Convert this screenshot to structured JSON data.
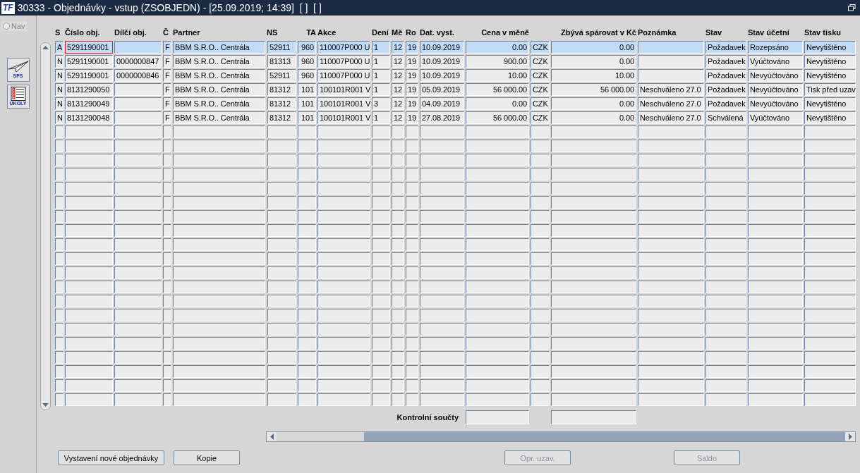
{
  "window": {
    "logo": "TF",
    "title": "30333 - Objednávky - vstup (ZSOBJEDN) - [25.09.2019; 14:39]  [ ]  [ ]"
  },
  "sidebar": {
    "nav": {
      "label": "Nav",
      "selected": false,
      "disabled": true
    },
    "buttons": [
      {
        "kind": "plane",
        "label": "SPS"
      },
      {
        "kind": "checklist",
        "label": "ÚKOLY"
      }
    ]
  },
  "table": {
    "columns": [
      "S",
      "Číslo obj.",
      "Dílčí obj.",
      "Č",
      "Partner",
      "NS",
      "TA",
      "Akce",
      "Dení",
      "Mě",
      "Ro",
      "Dat. vyst.",
      "Cena v měně",
      "",
      "Zbývá spárovat v Kč",
      "Poznámka",
      "Stav",
      "Stav účetní",
      "Stav tisku"
    ],
    "rows": [
      {
        "selected": true,
        "focused": true,
        "cells": [
          "A",
          "5291190001",
          null,
          "F",
          "BBM S.R.O.. Centrála",
          "52911",
          "960",
          "110007P000 U",
          "1",
          "12",
          "19",
          "10.09.2019",
          "0.00",
          "CZK",
          "0.00",
          null,
          "Požadavek",
          "Rozepsáno",
          "Nevytištěno"
        ]
      },
      {
        "selected": false,
        "focused": false,
        "cells": [
          "N",
          "5291190001",
          "0000000847",
          "F",
          "BBM S.R.O.. Centrála",
          "81313",
          "960",
          "110007P000 U",
          "1",
          "12",
          "19",
          "10.09.2019",
          "900.00",
          "CZK",
          "0.00",
          null,
          "Požadavek",
          "Vyúčtováno",
          "Nevytištěno"
        ]
      },
      {
        "selected": false,
        "focused": false,
        "cells": [
          "N",
          "5291190001",
          "0000000846",
          "F",
          "BBM S.R.O.. Centrála",
          "52911",
          "960",
          "110007P000 U",
          "1",
          "12",
          "19",
          "10.09.2019",
          "10.00",
          "CZK",
          "10.00",
          null,
          "Požadavek",
          "Nevyúčtováno",
          "Nevytištěno"
        ]
      },
      {
        "selected": false,
        "focused": false,
        "cells": [
          "N",
          "8131290050",
          null,
          "F",
          "BBM S.R.O.. Centrála",
          "81312",
          "101",
          "100101R001 V",
          "1",
          "12",
          "19",
          "05.09.2019",
          "56 000.00",
          "CZK",
          "56 000.00",
          "Neschváleno 27.0",
          "Požadavek",
          "Nevyúčtováno",
          "Tisk před uzav"
        ]
      },
      {
        "selected": false,
        "focused": false,
        "cells": [
          "N",
          "8131290049",
          null,
          "F",
          "BBM S.R.O.. Centrála",
          "81312",
          "101",
          "100101R001 V",
          "3",
          "12",
          "19",
          "04.09.2019",
          "0.00",
          "CZK",
          "0.00",
          "Neschváleno 27.0",
          "Požadavek",
          "Nevyúčtováno",
          "Nevytištěno"
        ]
      },
      {
        "selected": false,
        "focused": false,
        "cells": [
          "N",
          "8131290048",
          null,
          "F",
          "BBM S.R.O.. Centrála",
          "81312",
          "101",
          "100101R001 V",
          "1",
          "12",
          "19",
          "27.08.2019",
          "56 000.00",
          "CZK",
          "0.00",
          "Neschváleno 27.0",
          "Schválená",
          "Vyúčtováno",
          "Nevytištěno"
        ]
      }
    ]
  },
  "totals": {
    "label": "Kontrolní součty"
  },
  "buttons": [
    {
      "label": "Vystavení nové objednávky",
      "disabled": false
    },
    {
      "label": "Kopie",
      "disabled": false
    },
    {
      "label": "Opr. uzav.",
      "disabled": true
    },
    {
      "label": "Saldo",
      "disabled": true
    }
  ]
}
